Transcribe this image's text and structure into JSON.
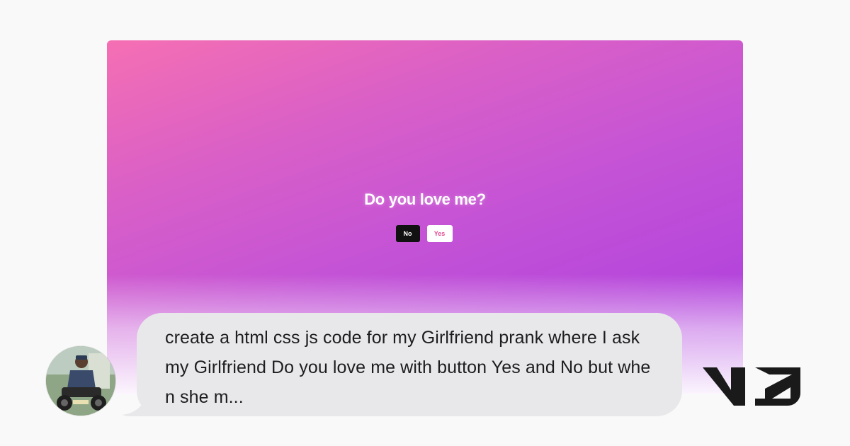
{
  "preview": {
    "question": "Do you love me?",
    "no_label": "No",
    "yes_label": "Yes",
    "gradient_colors": [
      "#f56fb3",
      "#c352d6",
      "#a93be0"
    ]
  },
  "chat": {
    "avatar_icon": "user-avatar-icon",
    "message": "create a html css js code for my Girlfriend prank where I ask my Girlfriend Do you love me with button Yes and No but when she m..."
  },
  "brand": {
    "logo_icon": "v0-logo-icon",
    "logo_text": "v0"
  }
}
